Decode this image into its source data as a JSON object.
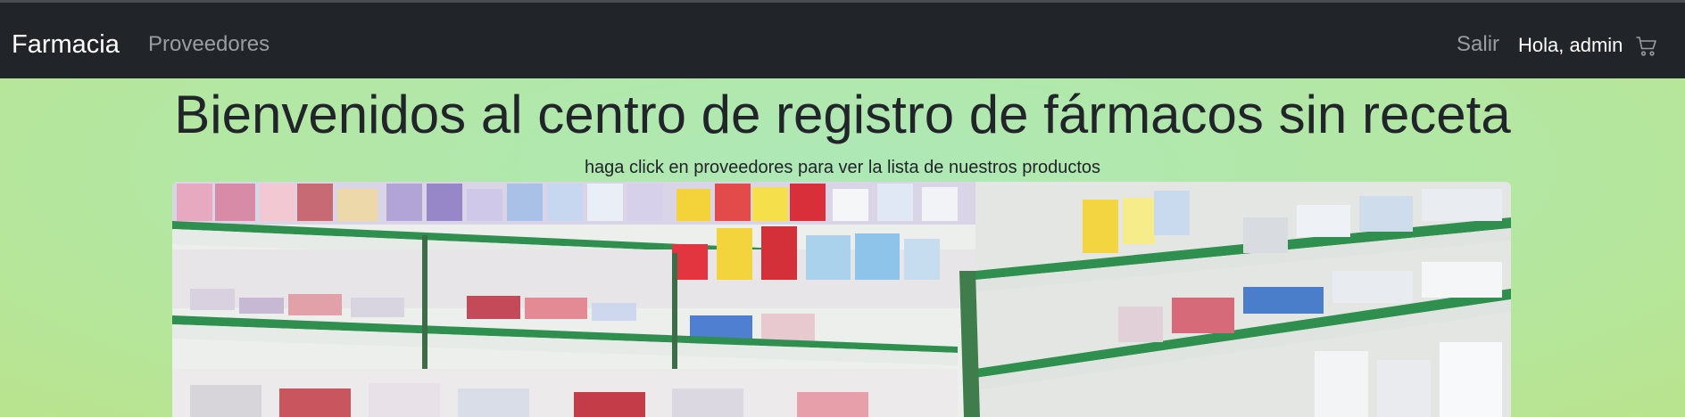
{
  "navbar": {
    "brand": "Farmacia",
    "links": [
      {
        "label": "Proveedores"
      }
    ],
    "logout_label": "Salir",
    "greeting": "Hola, admin",
    "cart_icon": "cart-icon",
    "background": "#212529"
  },
  "main": {
    "title": "Bienvenidos al centro de registro de fármacos sin receta",
    "subtitle": "haga click en proveedores para ver la lista de nuestros productos"
  },
  "colors": {
    "page_background": "#b3e7a3",
    "shelf_green": "#3aa15a"
  }
}
